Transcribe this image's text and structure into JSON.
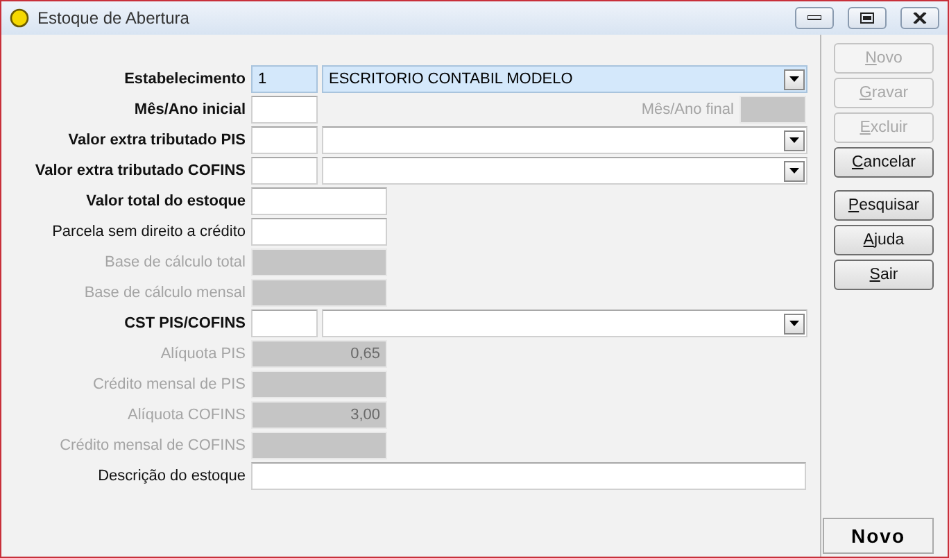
{
  "window": {
    "title": "Estoque de Abertura"
  },
  "rows": [
    {
      "kind": "code_combo",
      "label": "Estabelecimento",
      "bold": true,
      "code": "1",
      "value": "ESCRITORIO CONTABIL MODELO",
      "focused": true
    },
    {
      "kind": "month_range",
      "label": "Mês/Ano inicial",
      "bold": true,
      "end_label": "Mês/Ano final",
      "end_disabled": true
    },
    {
      "kind": "code_combo",
      "label": "Valor extra tributado PIS",
      "bold": true,
      "focused": false
    },
    {
      "kind": "code_combo",
      "label": "Valor extra tributado COFINS",
      "bold": true,
      "focused": false
    },
    {
      "kind": "field",
      "label": "Valor total do estoque",
      "bold": true,
      "disabled": false
    },
    {
      "kind": "field",
      "label": "Parcela sem direito a crédito",
      "bold": false,
      "disabled": false
    },
    {
      "kind": "field",
      "label": "Base de cálculo total",
      "bold": false,
      "disabled": true
    },
    {
      "kind": "field",
      "label": "Base de cálculo mensal",
      "bold": false,
      "disabled": true
    },
    {
      "kind": "code_combo",
      "label": "CST PIS/COFINS",
      "bold": true,
      "focused": false
    },
    {
      "kind": "field",
      "label": "Alíquota PIS",
      "bold": false,
      "disabled": true,
      "value": "0,65"
    },
    {
      "kind": "field",
      "label": "Crédito mensal de PIS",
      "bold": false,
      "disabled": true
    },
    {
      "kind": "field",
      "label": "Alíquota COFINS",
      "bold": false,
      "disabled": true,
      "value": "3,00"
    },
    {
      "kind": "field",
      "label": "Crédito mensal de COFINS",
      "bold": false,
      "disabled": true
    },
    {
      "kind": "wide_field",
      "label": "Descrição do estoque",
      "bold": false,
      "disabled": false
    }
  ],
  "button_groups": [
    [
      {
        "label": "Novo",
        "disabled": true
      },
      {
        "label": "Gravar",
        "disabled": true
      },
      {
        "label": "Excluir",
        "disabled": true
      },
      {
        "label": "Cancelar",
        "disabled": false
      }
    ],
    [
      {
        "label": "Pesquisar",
        "disabled": false
      },
      {
        "label": "Ajuda",
        "disabled": false
      },
      {
        "label": "Sair",
        "disabled": false
      }
    ]
  ],
  "status_bar": {
    "mode": "Novo"
  }
}
